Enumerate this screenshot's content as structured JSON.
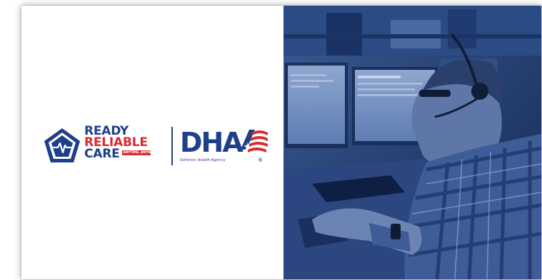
{
  "logos": {
    "rrc": {
      "line1": "READY",
      "line2": "RELIABLE",
      "line3": "CARE",
      "tagline": "ANYTIME, ANYWHERE"
    },
    "dha": {
      "letters": "DHA",
      "subtitle": "Defense Health Agency",
      "registered": "®"
    }
  },
  "colors": {
    "navy": "#1e3f8a",
    "red": "#d62b2e",
    "photo_tint": "#24447a"
  },
  "icons": {
    "rrc_shield": "pentagon-heartbeat-icon",
    "dha_flag": "flag-star-stripes-icon"
  }
}
